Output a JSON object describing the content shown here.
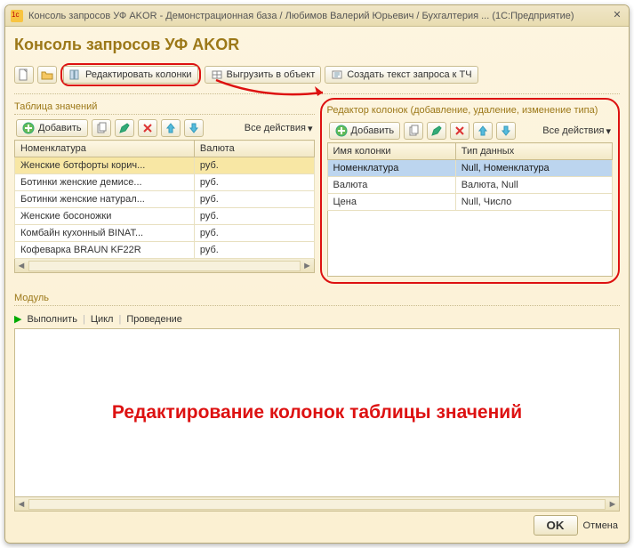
{
  "titlebar": {
    "text": "Консоль запросов УФ AKOR - Демонстрационная база / Любимов Валерий Юрьевич / Бухгалтерия ...  (1С:Предприятие)"
  },
  "heading": "Консоль запросов УФ AKOR",
  "main_toolbar": {
    "edit_columns": "Редактировать колонки",
    "export_object": "Выгрузить в объект",
    "create_query": "Создать текст запроса к ТЧ"
  },
  "left_pane": {
    "label": "Таблица значений",
    "add": "Добавить",
    "all_actions": "Все действия",
    "columns": [
      "Номенклатура",
      "Валюта"
    ],
    "rows": [
      {
        "c0": "Женские ботфорты корич...",
        "c1": "руб."
      },
      {
        "c0": "Ботинки женские демисе...",
        "c1": "руб."
      },
      {
        "c0": "Ботинки женские натурал...",
        "c1": "руб."
      },
      {
        "c0": "Женские босоножки",
        "c1": "руб."
      },
      {
        "c0": "Комбайн кухонный BINAT...",
        "c1": "руб."
      },
      {
        "c0": "Кофеварка BRAUN KF22R",
        "c1": "руб."
      }
    ]
  },
  "right_pane": {
    "label": "Редактор колонок (добавление, удаление, изменение типа)",
    "add": "Добавить",
    "all_actions": "Все действия",
    "columns": [
      "Имя колонки",
      "Тип данных"
    ],
    "rows": [
      {
        "c0": "Номенклатура",
        "c1": "Null, Номенклатура"
      },
      {
        "c0": "Валюта",
        "c1": "Валюта, Null"
      },
      {
        "c0": "Цена",
        "c1": "Null, Число"
      }
    ]
  },
  "module": {
    "label": "Модуль",
    "run": "Выполнить",
    "loop": "Цикл",
    "posting": "Проведение"
  },
  "annotation": "Редактирование колонок таблицы значений",
  "footer": {
    "ok": "OK",
    "cancel": "Отмена"
  }
}
